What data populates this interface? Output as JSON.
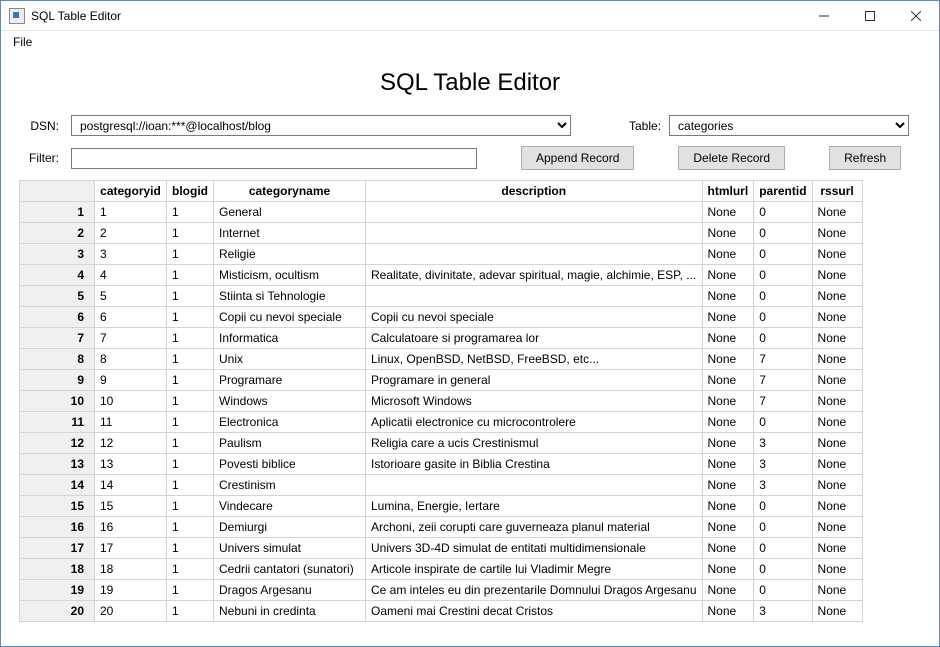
{
  "window": {
    "title": "SQL Table Editor"
  },
  "menu": {
    "file": "File"
  },
  "banner": "SQL Table Editor",
  "form": {
    "dsn_label": "DSN:",
    "dsn_value": "postgresql://ioan:***@localhost/blog",
    "table_label": "Table:",
    "table_value": "categories",
    "filter_label": "Filter:",
    "filter_value": ""
  },
  "buttons": {
    "append": "Append Record",
    "delete": "Delete Record",
    "refresh": "Refresh"
  },
  "columns": [
    "categoryid",
    "blogid",
    "categoryname",
    "description",
    "htmlurl",
    "parentid",
    "rssurl"
  ],
  "rows": [
    {
      "n": "1",
      "categoryid": "1",
      "blogid": "1",
      "categoryname": "General",
      "description": "",
      "htmlurl": "None",
      "parentid": "0",
      "rssurl": "None"
    },
    {
      "n": "2",
      "categoryid": "2",
      "blogid": "1",
      "categoryname": "Internet",
      "description": "",
      "htmlurl": "None",
      "parentid": "0",
      "rssurl": "None"
    },
    {
      "n": "3",
      "categoryid": "3",
      "blogid": "1",
      "categoryname": "Religie",
      "description": "",
      "htmlurl": "None",
      "parentid": "0",
      "rssurl": "None"
    },
    {
      "n": "4",
      "categoryid": "4",
      "blogid": "1",
      "categoryname": "Misticism, ocultism",
      "description": "Realitate, divinitate, adevar spiritual, magie, alchimie, ESP, ...",
      "htmlurl": "None",
      "parentid": "0",
      "rssurl": "None"
    },
    {
      "n": "5",
      "categoryid": "5",
      "blogid": "1",
      "categoryname": "Stiinta si Tehnologie",
      "description": "",
      "htmlurl": "None",
      "parentid": "0",
      "rssurl": "None"
    },
    {
      "n": "6",
      "categoryid": "6",
      "blogid": "1",
      "categoryname": "Copii cu nevoi speciale",
      "description": "Copii cu nevoi speciale",
      "htmlurl": "None",
      "parentid": "0",
      "rssurl": "None"
    },
    {
      "n": "7",
      "categoryid": "7",
      "blogid": "1",
      "categoryname": "Informatica",
      "description": "Calculatoare si programarea lor",
      "htmlurl": "None",
      "parentid": "0",
      "rssurl": "None"
    },
    {
      "n": "8",
      "categoryid": "8",
      "blogid": "1",
      "categoryname": "Unix",
      "description": "Linux, OpenBSD, NetBSD, FreeBSD, etc...",
      "htmlurl": "None",
      "parentid": "7",
      "rssurl": "None"
    },
    {
      "n": "9",
      "categoryid": "9",
      "blogid": "1",
      "categoryname": "Programare",
      "description": "Programare in general",
      "htmlurl": "None",
      "parentid": "7",
      "rssurl": "None"
    },
    {
      "n": "10",
      "categoryid": "10",
      "blogid": "1",
      "categoryname": "Windows",
      "description": "Microsoft Windows",
      "htmlurl": "None",
      "parentid": "7",
      "rssurl": "None"
    },
    {
      "n": "11",
      "categoryid": "11",
      "blogid": "1",
      "categoryname": "Electronica",
      "description": "Aplicatii electronice cu microcontrolere",
      "htmlurl": "None",
      "parentid": "0",
      "rssurl": "None"
    },
    {
      "n": "12",
      "categoryid": "12",
      "blogid": "1",
      "categoryname": "Paulism",
      "description": "Religia care a ucis Crestinismul",
      "htmlurl": "None",
      "parentid": "3",
      "rssurl": "None"
    },
    {
      "n": "13",
      "categoryid": "13",
      "blogid": "1",
      "categoryname": "Povesti biblice",
      "description": "Istorioare gasite in Biblia Crestina",
      "htmlurl": "None",
      "parentid": "3",
      "rssurl": "None"
    },
    {
      "n": "14",
      "categoryid": "14",
      "blogid": "1",
      "categoryname": "Crestinism",
      "description": "",
      "htmlurl": "None",
      "parentid": "3",
      "rssurl": "None"
    },
    {
      "n": "15",
      "categoryid": "15",
      "blogid": "1",
      "categoryname": "Vindecare",
      "description": "Lumina, Energie, Iertare",
      "htmlurl": "None",
      "parentid": "0",
      "rssurl": "None"
    },
    {
      "n": "16",
      "categoryid": "16",
      "blogid": "1",
      "categoryname": "Demiurgi",
      "description": "Archoni, zeii corupti care guverneaza planul material",
      "htmlurl": "None",
      "parentid": "0",
      "rssurl": "None"
    },
    {
      "n": "17",
      "categoryid": "17",
      "blogid": "1",
      "categoryname": "Univers simulat",
      "description": "Univers 3D-4D simulat de entitati multidimensionale",
      "htmlurl": "None",
      "parentid": "0",
      "rssurl": "None"
    },
    {
      "n": "18",
      "categoryid": "18",
      "blogid": "1",
      "categoryname": "Cedrii cantatori (sunatori)",
      "description": "Articole inspirate de cartile lui Vladimir Megre",
      "htmlurl": "None",
      "parentid": "0",
      "rssurl": "None"
    },
    {
      "n": "19",
      "categoryid": "19",
      "blogid": "1",
      "categoryname": "Dragos Argesanu",
      "description": "Ce am inteles eu din prezentarile Domnului Dragos Argesanu",
      "htmlurl": "None",
      "parentid": "0",
      "rssurl": "None"
    },
    {
      "n": "20",
      "categoryid": "20",
      "blogid": "1",
      "categoryname": "Nebuni in credinta",
      "description": "Oameni mai Crestini decat Cristos",
      "htmlurl": "None",
      "parentid": "3",
      "rssurl": "None"
    }
  ]
}
